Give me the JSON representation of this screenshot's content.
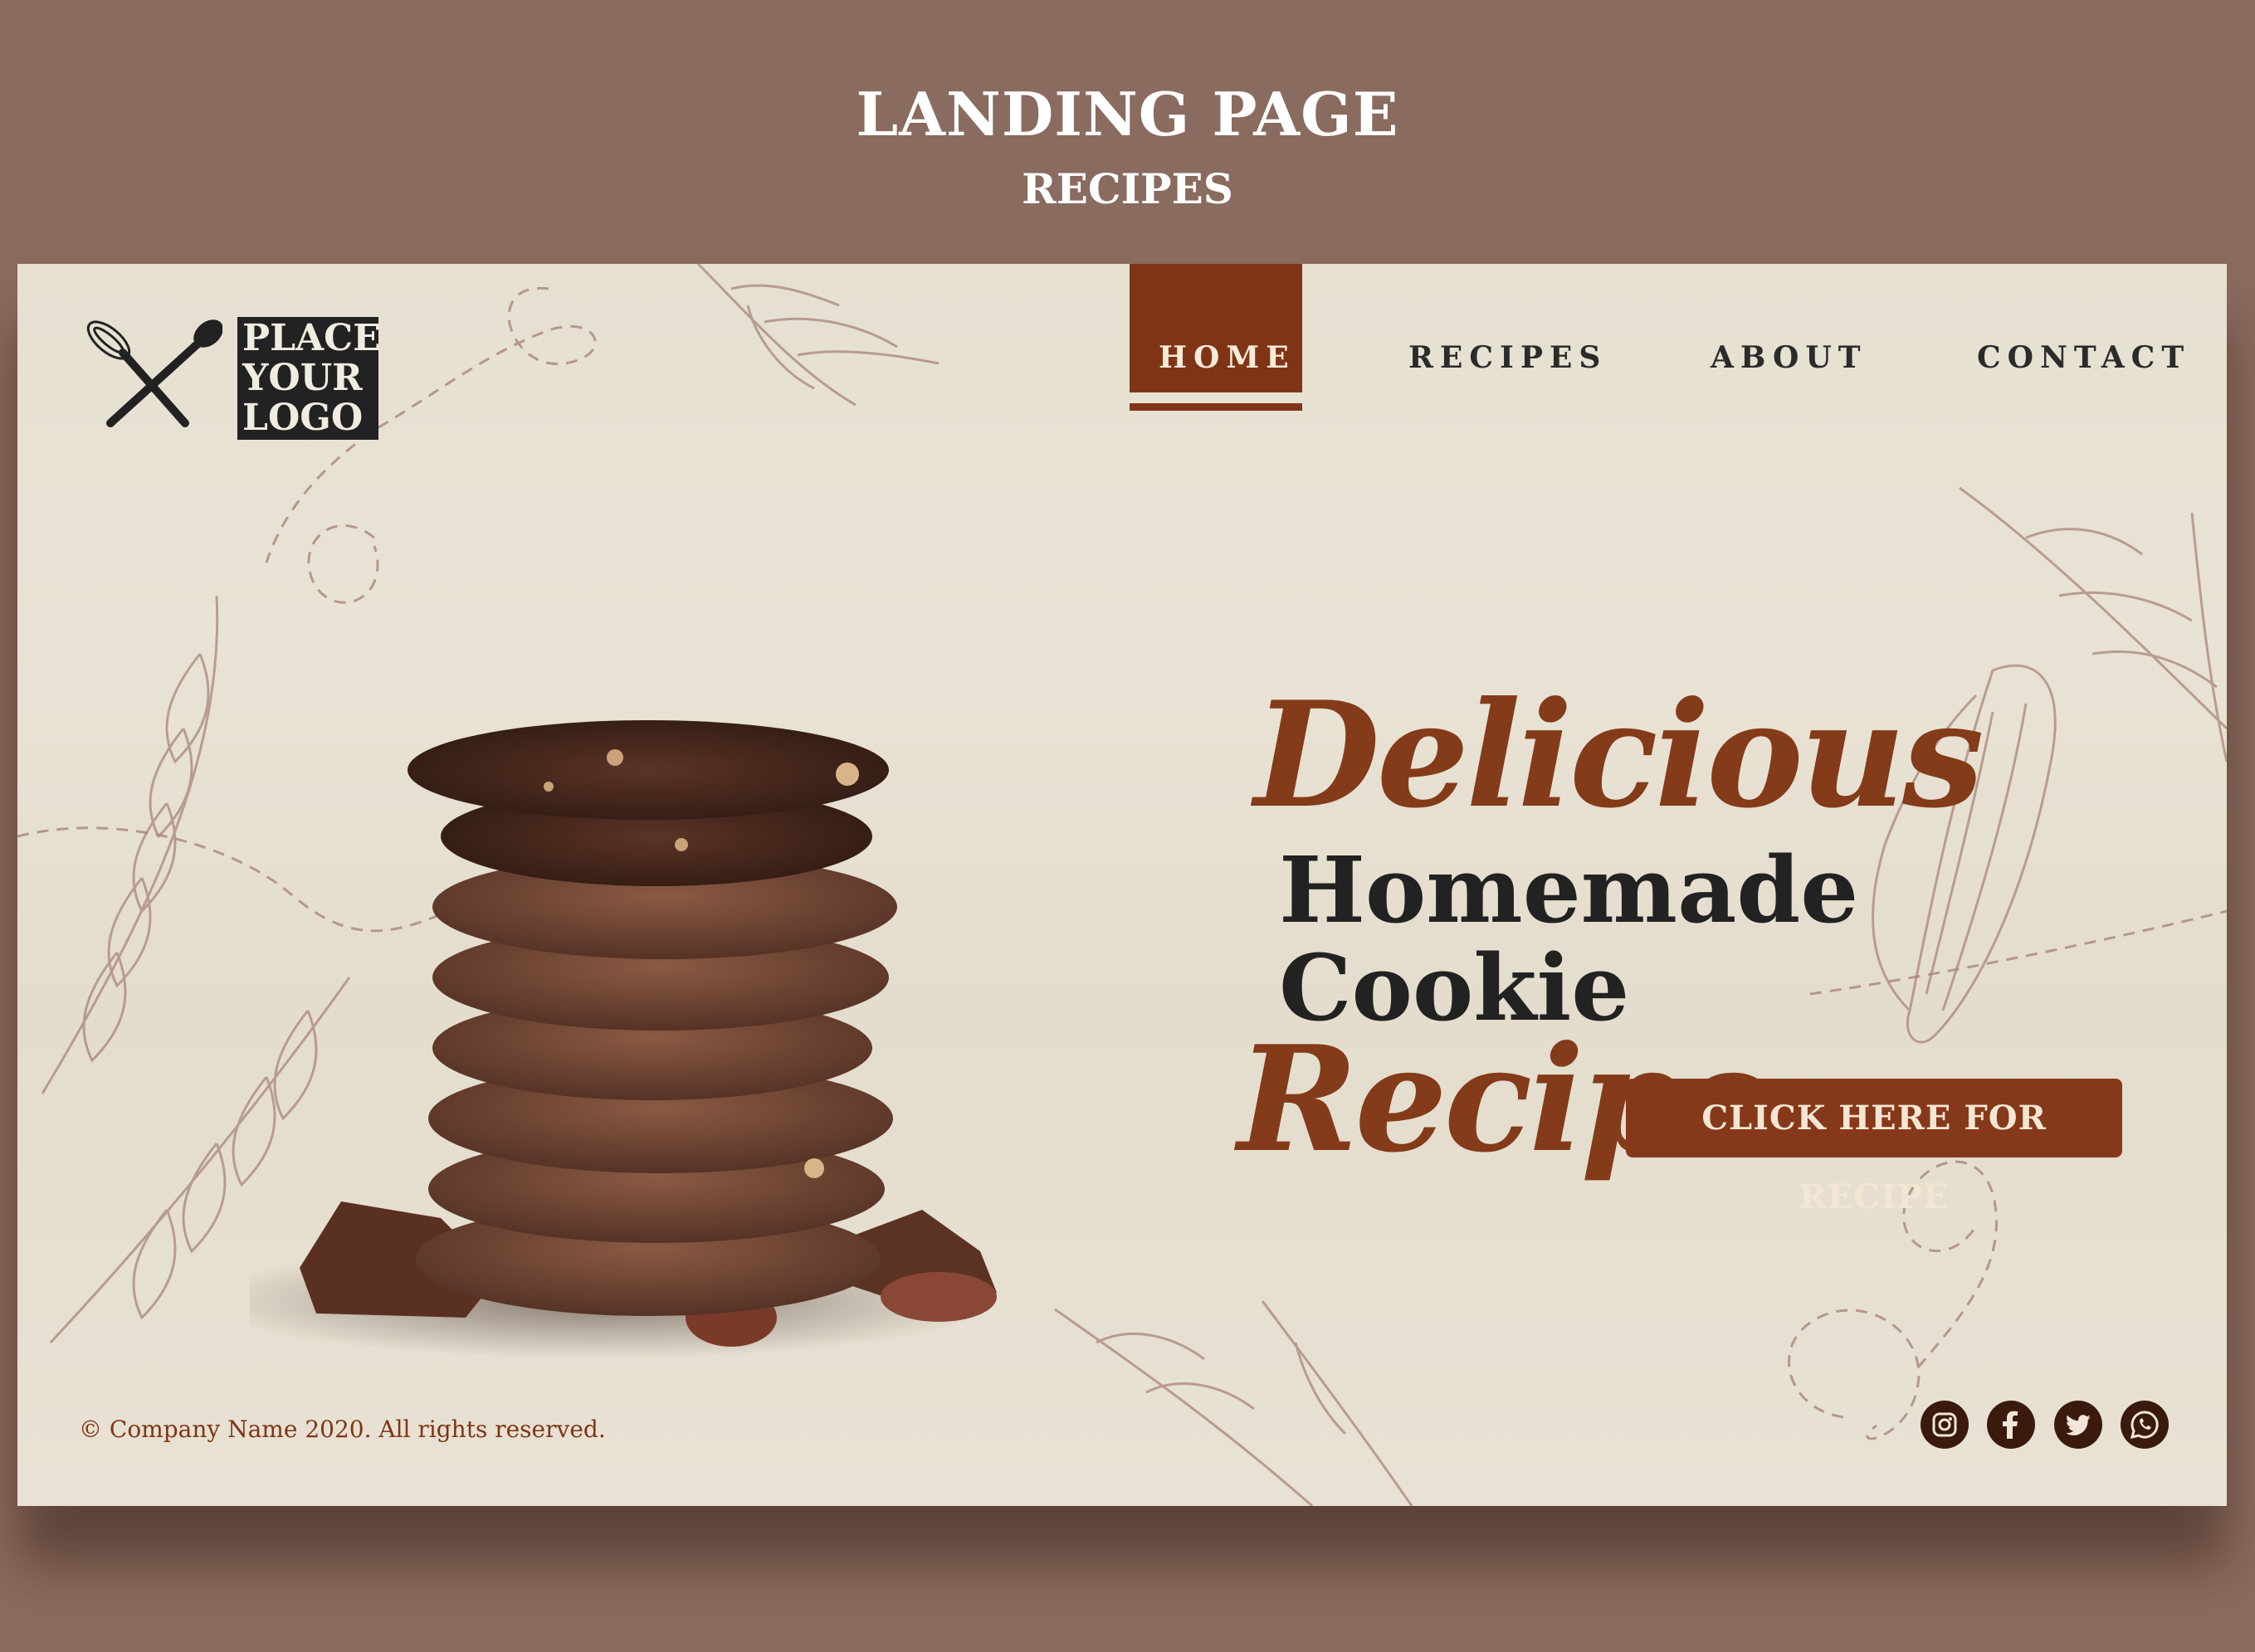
{
  "showcase": {
    "title": "LANDING PAGE",
    "subtitle": "RECIPES"
  },
  "logo": {
    "line1": "PLACE",
    "line2": "YOUR",
    "line3": "LOGO",
    "icon": "whisk-spoon-icon"
  },
  "nav": {
    "items": [
      {
        "label": "HOME",
        "active": true
      },
      {
        "label": "RECIPES",
        "active": false
      },
      {
        "label": "ABOUT",
        "active": false
      },
      {
        "label": "CONTACT",
        "active": false
      }
    ]
  },
  "hero": {
    "word1": "Delicious",
    "word2": "Homemade",
    "word3": "Cookie",
    "word4": "Recipe",
    "cta_label": "CLICK HERE FOR RECIPE",
    "image": "chocolate-cookie-stack"
  },
  "footer": {
    "copyright": "© Company Name 2020. All rights reserved.",
    "social": [
      "instagram-icon",
      "facebook-icon",
      "twitter-icon",
      "whatsapp-icon"
    ]
  },
  "colors": {
    "page_background": "#8a6b5f",
    "mock_background": "#e7e1d3",
    "accent": "#833b1a",
    "text_dark": "#222222",
    "social_bg": "#3a1a0d"
  }
}
